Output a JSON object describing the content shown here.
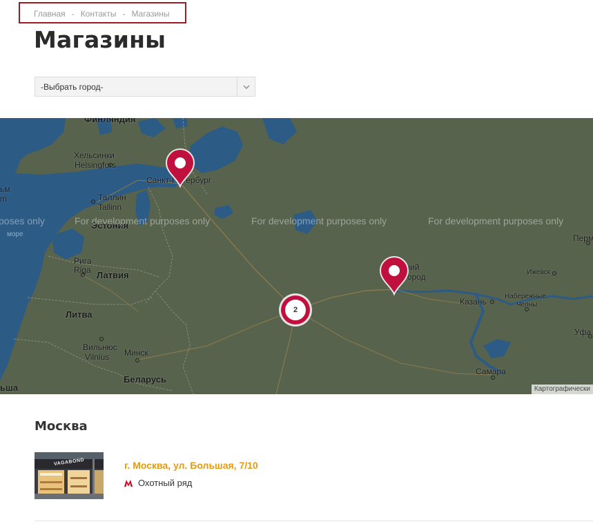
{
  "breadcrumb": {
    "items": [
      "Главная",
      "Контакты",
      "Магазины"
    ],
    "separator": "-"
  },
  "page": {
    "title": "Магазины"
  },
  "city_select": {
    "value": "-Выбрать город-"
  },
  "map": {
    "watermark": "For development purposes only",
    "watermark_partial": "poses only",
    "attribution": "Картографически",
    "labels": {
      "finland": "Финляндия",
      "helsinki_ru": "Хельсинки",
      "helsinki_en": "Helsingfors",
      "spb": "Санкт-Петербург",
      "tallinn_ru": "Таллин",
      "tallinn_en": "Tallinn",
      "estonia": "Эстония",
      "sea": "море",
      "riga_ru": "Рига",
      "riga_en": "Riga",
      "latvia": "Латвия",
      "lithuania": "Литва",
      "vilnius_ru": "Вильнюс",
      "vilnius_en": "Vilnius",
      "minsk": "Минск",
      "belarus": "Беларусь",
      "nnovgorod_1": "Нижний",
      "nnovgorod_2": "Новгород",
      "kazan": "Казань",
      "izhevsk": "Ижевск",
      "chelny_1": "Набережные",
      "chelny_2": "Челны",
      "samara": "Самара",
      "perm_partial": "Перм",
      "ufa_partial": "Уфа",
      "stockholm_partial": "ьм",
      "stockholm_partial2": "m",
      "poland_partial": "ьша"
    },
    "cluster_count": "2",
    "colors": {
      "land": "#57634d",
      "water": "#2c5b86",
      "marker": "#c0103e"
    }
  },
  "city_section": {
    "title": "Москва"
  },
  "store": {
    "address": "г. Москва, ул. Большая, 7/10",
    "metro_icon": "metro-icon",
    "metro": "Охотный ряд",
    "photo_sign": "VAGABOND"
  }
}
